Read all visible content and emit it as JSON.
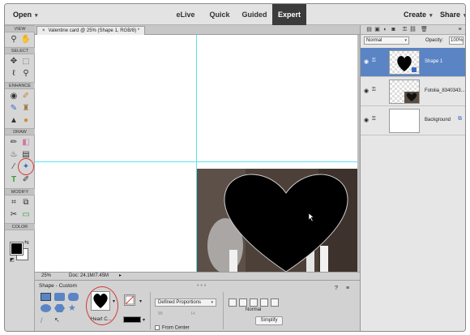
{
  "topbar": {
    "open_label": "Open",
    "modes": [
      "eLive",
      "Quick",
      "Guided",
      "Expert"
    ],
    "active_mode": "Expert",
    "create_label": "Create",
    "share_label": "Share"
  },
  "toolbox": {
    "sections": [
      "VIEW",
      "SELECT",
      "ENHANCE",
      "DRAW",
      "MODIFY",
      "COLOR"
    ],
    "active_tool": "custom-shape-tool"
  },
  "document": {
    "tab_close": "×",
    "tab_title": "Valentine card @ 25% (Shape 1, RGB/8) *",
    "zoom": "25%",
    "doc_size": "Doc: 24.1M/7.45M"
  },
  "options_bar": {
    "title": "Shape - Custom",
    "shape_name": "Heart C...",
    "proportions_value": "Defined Proportions",
    "w_label": "W:",
    "h_label": "H:",
    "from_center_label": "From Center",
    "mode_label": "Normal",
    "simplify_label": "Simplify"
  },
  "layers_panel": {
    "blend_mode": "Normal",
    "opacity_label": "Opacity:",
    "opacity_value": "100%",
    "layers": [
      {
        "name": "Shape 1",
        "selected": true
      },
      {
        "name": "Fotolia_8340343...",
        "selected": false
      },
      {
        "name": "Background",
        "selected": false
      }
    ]
  },
  "colors": {
    "accent": "#5b84c4",
    "active_mode_bg": "#3b3b3b",
    "highlight": "#d23b3b",
    "guide": "#5fe3ef",
    "foreground": "#000000",
    "background": "#ffffff"
  }
}
